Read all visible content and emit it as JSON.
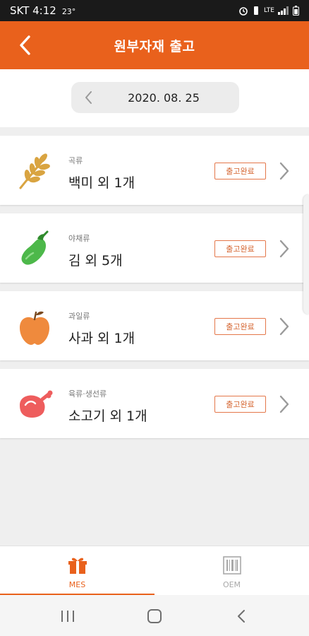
{
  "status_bar": {
    "carrier_time": "SKT 4:12",
    "temperature": "23°",
    "network": "LTE"
  },
  "header": {
    "title": "원부자재 출고"
  },
  "date_selector": {
    "date": "2020. 08. 25"
  },
  "items": [
    {
      "category": "곡류",
      "title": "백미 외 1개",
      "status": "출고완료",
      "icon": "wheat-icon",
      "color": "#d9a441"
    },
    {
      "category": "야채류",
      "title": "김 외 5개",
      "status": "출고완료",
      "icon": "eggplant-icon",
      "color": "#4db84a"
    },
    {
      "category": "과일류",
      "title": "사과 외 1개",
      "status": "출고완료",
      "icon": "apple-icon",
      "color": "#ef8a3d"
    },
    {
      "category": "육류·생선류",
      "title": "소고기 외 1개",
      "status": "출고완료",
      "icon": "meat-icon",
      "color": "#ee5d5d"
    }
  ],
  "bottom_nav": {
    "tabs": [
      {
        "label": "MES",
        "icon": "gift-box-icon",
        "active": true
      },
      {
        "label": "OEM",
        "icon": "barcode-icon",
        "active": false
      }
    ]
  },
  "colors": {
    "accent": "#e9611c",
    "badge_border": "#e4774a"
  }
}
